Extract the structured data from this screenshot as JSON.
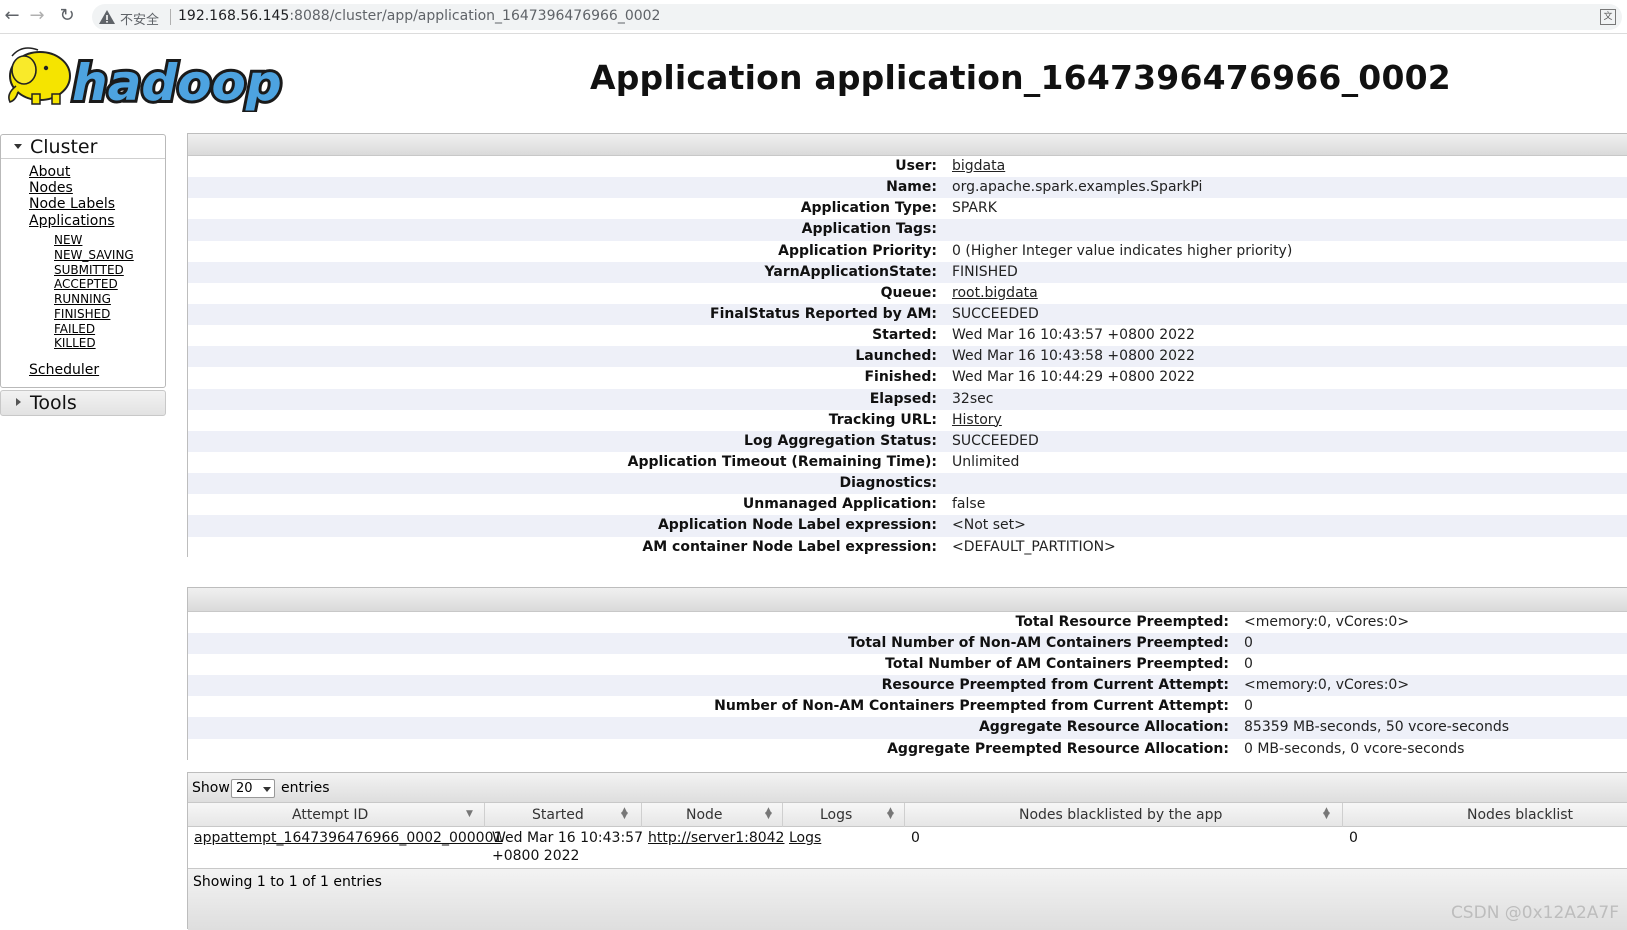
{
  "browser": {
    "insecure_label": "不安全",
    "url_host": "192.168.56.145",
    "url_path": ":8088/cluster/app/application_1647396476966_0002"
  },
  "header": {
    "logo_text": "hadoop",
    "title": "Application application_1647396476966_0002"
  },
  "sidebar": {
    "cluster_label": "Cluster",
    "links": [
      "About",
      "Nodes",
      "Node Labels",
      "Applications"
    ],
    "app_states": [
      "NEW",
      "NEW_SAVING",
      "SUBMITTED",
      "ACCEPTED",
      "RUNNING",
      "FINISHED",
      "FAILED",
      "KILLED"
    ],
    "scheduler": "Scheduler",
    "tools_label": "Tools"
  },
  "overview": [
    {
      "label": "User:",
      "value": "bigdata",
      "link": true
    },
    {
      "label": "Name:",
      "value": "org.apache.spark.examples.SparkPi"
    },
    {
      "label": "Application Type:",
      "value": "SPARK"
    },
    {
      "label": "Application Tags:",
      "value": ""
    },
    {
      "label": "Application Priority:",
      "value": "0 (Higher Integer value indicates higher priority)"
    },
    {
      "label": "YarnApplicationState:",
      "value": "FINISHED"
    },
    {
      "label": "Queue:",
      "value": "root.bigdata",
      "link": true
    },
    {
      "label": "FinalStatus Reported by AM:",
      "value": "SUCCEEDED"
    },
    {
      "label": "Started:",
      "value": "Wed Mar 16 10:43:57 +0800 2022"
    },
    {
      "label": "Launched:",
      "value": "Wed Mar 16 10:43:58 +0800 2022"
    },
    {
      "label": "Finished:",
      "value": "Wed Mar 16 10:44:29 +0800 2022"
    },
    {
      "label": "Elapsed:",
      "value": "32sec"
    },
    {
      "label": "Tracking URL:",
      "value": "History",
      "link": true
    },
    {
      "label": "Log Aggregation Status:",
      "value": "SUCCEEDED"
    },
    {
      "label": "Application Timeout (Remaining Time):",
      "value": "Unlimited"
    },
    {
      "label": "Diagnostics:",
      "value": ""
    },
    {
      "label": "Unmanaged Application:",
      "value": "false"
    },
    {
      "label": "Application Node Label expression:",
      "value": "<Not set>"
    },
    {
      "label": "AM container Node Label expression:",
      "value": "<DEFAULT_PARTITION>"
    }
  ],
  "metrics": [
    {
      "label": "Total Resource Preempted:",
      "value": "<memory:0, vCores:0>"
    },
    {
      "label": "Total Number of Non-AM Containers Preempted:",
      "value": "0"
    },
    {
      "label": "Total Number of AM Containers Preempted:",
      "value": "0"
    },
    {
      "label": "Resource Preempted from Current Attempt:",
      "value": "<memory:0, vCores:0>"
    },
    {
      "label": "Number of Non-AM Containers Preempted from Current Attempt:",
      "value": "0"
    },
    {
      "label": "Aggregate Resource Allocation:",
      "value": "85359 MB-seconds, 50 vcore-seconds"
    },
    {
      "label": "Aggregate Preempted Resource Allocation:",
      "value": "0 MB-seconds, 0 vcore-seconds"
    }
  ],
  "attempts": {
    "show_label": "Show",
    "page_size": "20",
    "entries_label": "entries",
    "columns": [
      "Attempt ID",
      "Started",
      "Node",
      "Logs",
      "Nodes blacklisted by the app",
      "Nodes blacklist"
    ],
    "rows": [
      {
        "attempt_id": "appattempt_1647396476966_0002_000001",
        "started_line1": "Wed Mar 16 10:43:57",
        "started_line2": "+0800 2022",
        "node": "http://server1:8042",
        "logs": "Logs",
        "blacklisted_app": "0",
        "blacklisted_system": "0"
      }
    ],
    "footer": "Showing 1 to 1 of 1 entries"
  },
  "watermark": "CSDN @0x12A2A7F"
}
